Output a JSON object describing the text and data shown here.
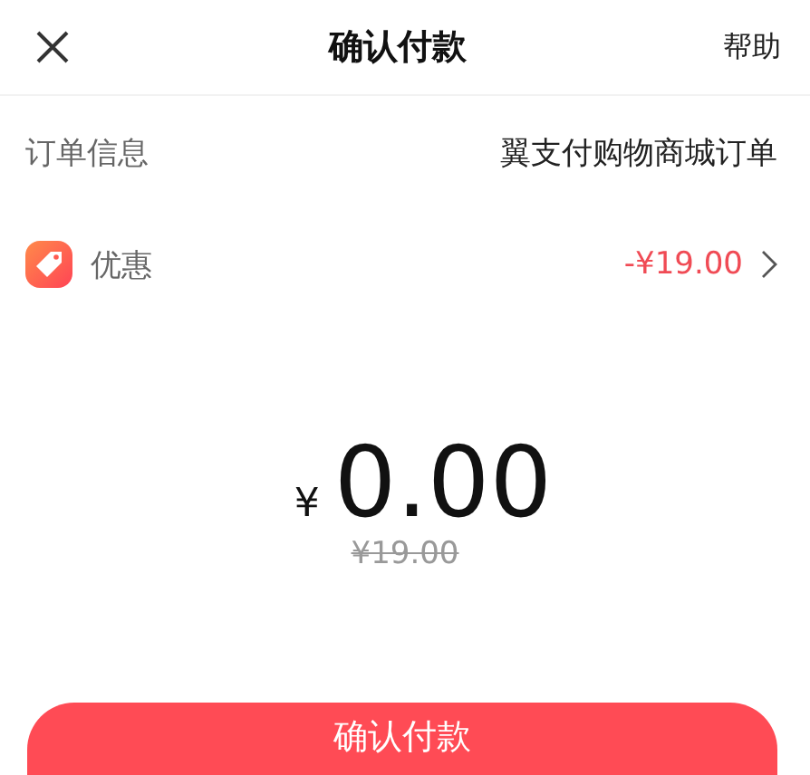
{
  "header": {
    "title": "确认付款",
    "help": "帮助"
  },
  "rows": [
    {
      "kind": "info",
      "label": "订单信息",
      "value": "翼支付购物商城订单"
    },
    {
      "kind": "discount",
      "label": "优惠",
      "value": "-¥19.00"
    }
  ],
  "amount": {
    "currency": "¥",
    "value": "0.00",
    "original": "¥19.00"
  },
  "confirm_button": "确认付款"
}
